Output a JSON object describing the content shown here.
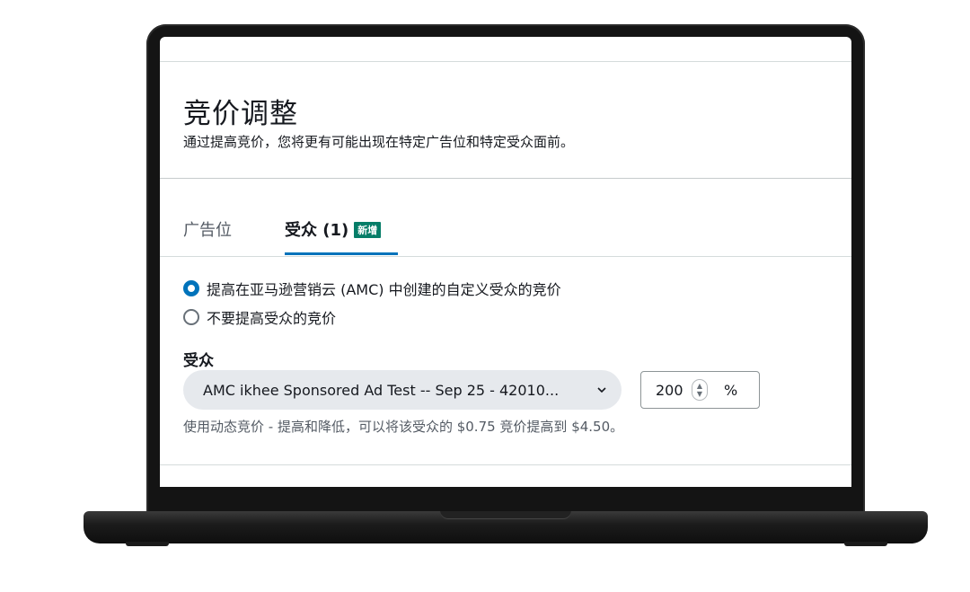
{
  "header": {
    "title": "竞价调整",
    "subtitle": "通过提高竞价，您将更有可能出现在特定广告位和特定受众面前。"
  },
  "tabs": [
    {
      "label": "广告位",
      "active": false
    },
    {
      "label": "受众 (1)",
      "badge": "新增",
      "active": true
    }
  ],
  "radio_options": [
    {
      "label": "提高在亚马逊营销云 (AMC) 中创建的自定义受众的竞价",
      "selected": true
    },
    {
      "label": "不要提高受众的竞价",
      "selected": false
    }
  ],
  "audience": {
    "label": "受众",
    "select_value": "AMC ikhee Sponsored Ad Test -- Sep 25 - 42010...",
    "percent_value": "200",
    "percent_unit": "%",
    "helper_text": "使用动态竞价 - 提高和降低，可以将该受众的 $0.75 竞价提高到 $4.50。"
  },
  "colors": {
    "accent": "#0073bb",
    "badge": "#067d68"
  }
}
